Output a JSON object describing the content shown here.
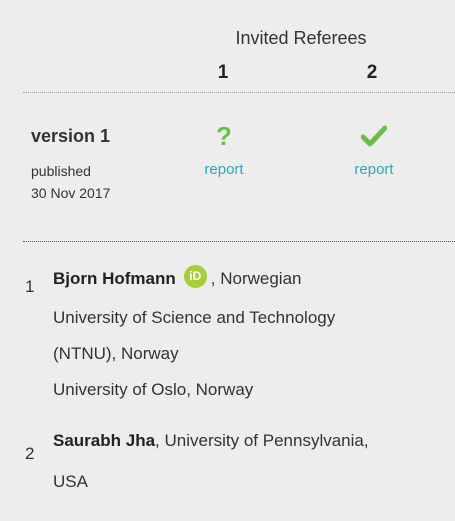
{
  "header": {
    "title": "Invited Referees",
    "columns": [
      "1",
      "2"
    ]
  },
  "version": {
    "label": "version 1",
    "published_label": "published",
    "published_date": "30 Nov 2017",
    "statuses": [
      {
        "icon": "question-icon",
        "color": "#6bbe45",
        "link": "report"
      },
      {
        "icon": "check-icon",
        "color": "#6bbe45",
        "link": "report"
      }
    ]
  },
  "referees": [
    {
      "number": "1",
      "name": "Bjorn Hofmann",
      "affiliation_first": ", Norwegian",
      "lines": [
        "University of Science and Technology",
        "(NTNU), Norway",
        "University of Oslo, Norway"
      ]
    },
    {
      "number": "2",
      "name": "Saurabh Jha",
      "affiliation_first": ", University of Pennsylvania,",
      "lines": [
        "USA"
      ]
    }
  ],
  "colors": {
    "background": "#ededed",
    "link": "#2fa8b9",
    "status_green": "#6bbe45",
    "orcid_green": "#a6ce39"
  }
}
